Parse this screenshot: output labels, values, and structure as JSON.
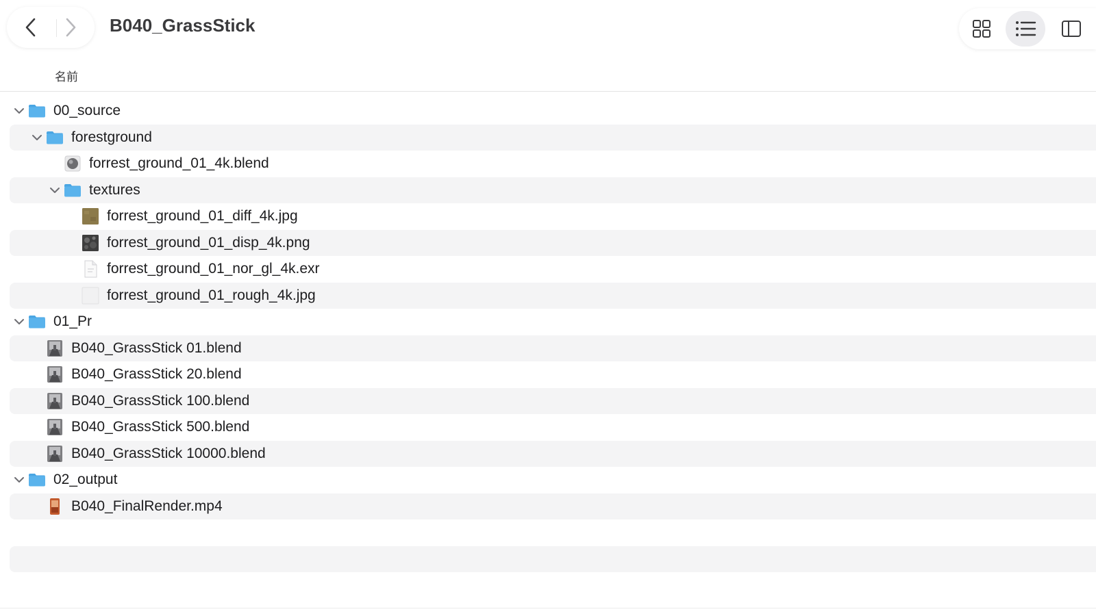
{
  "window": {
    "title": "B040_GrassStick",
    "back_icon": "chevron-left-icon",
    "forward_icon": "chevron-right-icon",
    "view_modes": [
      {
        "name": "icon-view",
        "icon": "grid-icon",
        "selected": false
      },
      {
        "name": "list-view",
        "icon": "list-icon",
        "selected": true
      },
      {
        "name": "column-view",
        "icon": "column-icon",
        "selected": false
      }
    ]
  },
  "column_header": {
    "name_label": "名前"
  },
  "colors": {
    "folder": "#5ab3ec",
    "folder_tab": "#4aa6e3",
    "row_alt": "#f4f4f5",
    "mp4_icon": "#c25a2d"
  },
  "files": [
    {
      "name": "00_source",
      "kind": "folder",
      "icon": "folder-icon",
      "depth": 0,
      "expanded": true
    },
    {
      "name": "forestground",
      "kind": "folder",
      "icon": "folder-icon",
      "depth": 1,
      "expanded": true
    },
    {
      "name": "forrest_ground_01_4k.blend",
      "kind": "blend-sphere",
      "icon": "blend-file-icon",
      "depth": 2
    },
    {
      "name": "textures",
      "kind": "folder",
      "icon": "folder-icon",
      "depth": 2,
      "expanded": true
    },
    {
      "name": "forrest_ground_01_diff_4k.jpg",
      "kind": "image-diff",
      "icon": "image-thumbnail-icon",
      "depth": 3
    },
    {
      "name": "forrest_ground_01_disp_4k.png",
      "kind": "image-disp",
      "icon": "image-thumbnail-icon",
      "depth": 3
    },
    {
      "name": "forrest_ground_01_nor_gl_4k.exr",
      "kind": "document",
      "icon": "document-icon",
      "depth": 3
    },
    {
      "name": "forrest_ground_01_rough_4k.jpg",
      "kind": "image-rough",
      "icon": "image-thumbnail-icon",
      "depth": 3
    },
    {
      "name": "01_Pr",
      "kind": "folder",
      "icon": "folder-icon",
      "depth": 0,
      "expanded": true
    },
    {
      "name": "B040_GrassStick 01.blend",
      "kind": "blend-scene",
      "icon": "blend-file-icon",
      "depth": 1
    },
    {
      "name": "B040_GrassStick 20.blend",
      "kind": "blend-scene",
      "icon": "blend-file-icon",
      "depth": 1
    },
    {
      "name": "B040_GrassStick 100.blend",
      "kind": "blend-scene",
      "icon": "blend-file-icon",
      "depth": 1
    },
    {
      "name": "B040_GrassStick 500.blend",
      "kind": "blend-scene",
      "icon": "blend-file-icon",
      "depth": 1
    },
    {
      "name": "B040_GrassStick 10000.blend",
      "kind": "blend-scene",
      "icon": "blend-file-icon",
      "depth": 1
    },
    {
      "name": "02_output",
      "kind": "folder",
      "icon": "folder-icon",
      "depth": 0,
      "expanded": true
    },
    {
      "name": "B040_FinalRender.mp4",
      "kind": "video",
      "icon": "video-file-icon",
      "depth": 1
    }
  ]
}
